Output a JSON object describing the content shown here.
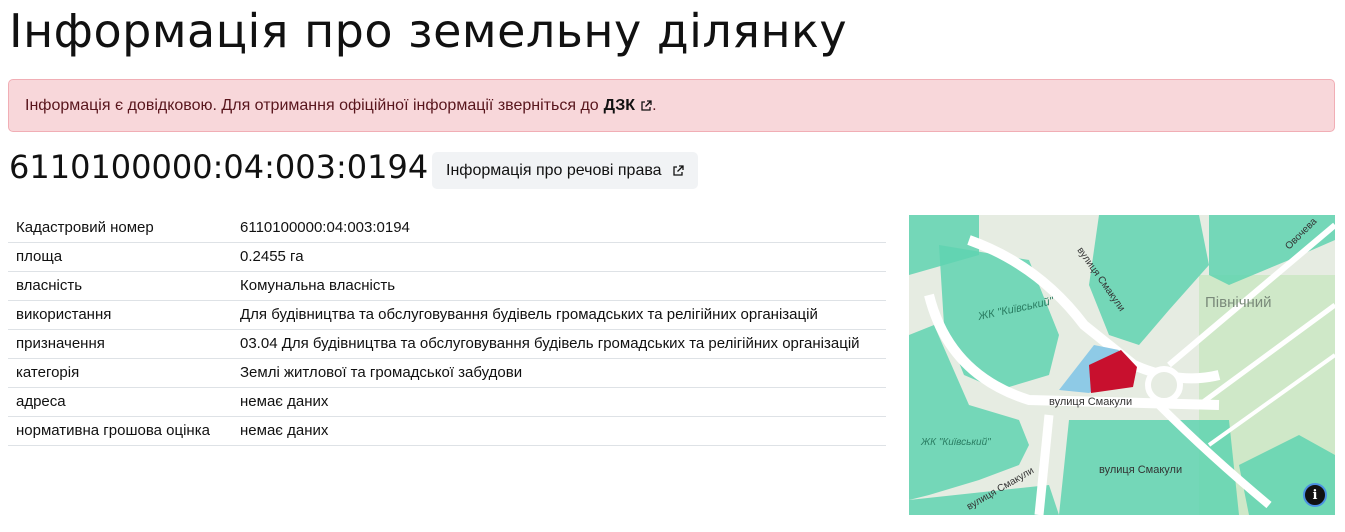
{
  "page": {
    "title": "Інформація про земельну ділянку"
  },
  "alert": {
    "text": "Інформація є довідковою. Для отримання офіційної інформації зверніться до",
    "link_label": "ДЗК",
    "suffix": "."
  },
  "parcel": {
    "cadastral_heading": "6110100000:04:003:0194",
    "rights_button_label": "Інформація про речові права"
  },
  "details": {
    "rows": [
      {
        "key": "Кадастровий номер",
        "value": "6110100000:04:003:0194"
      },
      {
        "key": "площа",
        "value": "0.2455 га"
      },
      {
        "key": "власність",
        "value": "Комунальна власність"
      },
      {
        "key": "використання",
        "value": "Для будівництва та обслуговування будівель громадських та релігійних організацій"
      },
      {
        "key": "призначення",
        "value": "03.04 Для будівництва та обслуговування будівель громадських та релігійних організацій"
      },
      {
        "key": "категорія",
        "value": "Землі житлової та громадської забудови"
      },
      {
        "key": "адреса",
        "value": "немає даних"
      },
      {
        "key": "нормативна грошова оцінка",
        "value": "немає даних"
      }
    ]
  },
  "map": {
    "labels": {
      "street1": "вулиця Смакули",
      "street2": "вулиця Смакули",
      "street3": "вулиця Смакули",
      "street4": "вулиця Смакули",
      "complex1": "ЖК \"Київський\"",
      "complex2": "ЖК \"Київський\"",
      "district": "Північний",
      "street5": "Овочева"
    },
    "info_button": "i",
    "colors": {
      "parcel": "#c8102e",
      "neighbor": "#8ecae6",
      "zone": "#5fd3b0"
    }
  }
}
